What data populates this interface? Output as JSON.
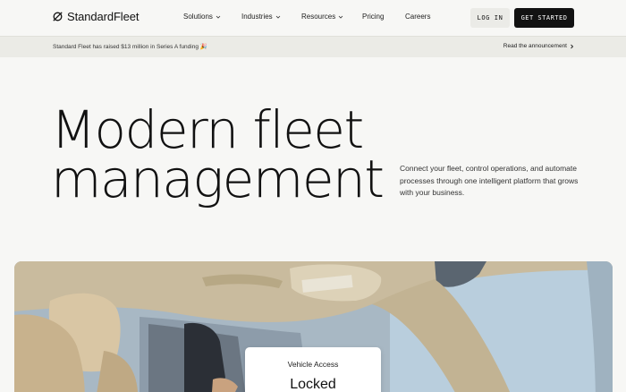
{
  "brand": {
    "name": "StandardFleet",
    "logo_icon": "slashed-circle-logo-icon"
  },
  "nav": {
    "items": [
      {
        "label": "Solutions",
        "has_dropdown": true
      },
      {
        "label": "Industries",
        "has_dropdown": true
      },
      {
        "label": "Resources",
        "has_dropdown": true
      },
      {
        "label": "Pricing",
        "has_dropdown": false
      },
      {
        "label": "Careers",
        "has_dropdown": false
      }
    ],
    "login_label": "LOG IN",
    "cta_label": "GET STARTED"
  },
  "announcement": {
    "text": "Standard Fleet has raised $13 million in Series A funding 🎉",
    "link_label": "Read the announcement"
  },
  "hero": {
    "title_line1": "Modern fleet",
    "title_line2": "management",
    "subtitle": "Connect your fleet, control operations, and automate processes through one intelligent platform that grows with your business."
  },
  "vehicle_card": {
    "label": "Vehicle Access",
    "value": "Locked"
  },
  "colors": {
    "page_bg": "#f7f7f5",
    "announce_bg": "#ebebe6",
    "cta_bg": "#121212",
    "login_bg": "#ebebe7"
  }
}
